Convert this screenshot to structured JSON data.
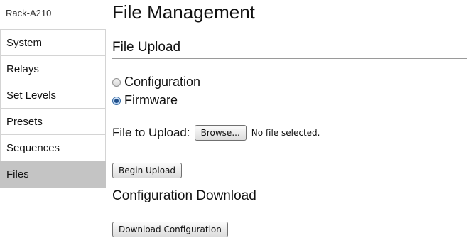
{
  "device": {
    "name": "Rack-A210"
  },
  "sidebar": {
    "items": [
      {
        "label": "System",
        "active": false
      },
      {
        "label": "Relays",
        "active": false
      },
      {
        "label": "Set Levels",
        "active": false
      },
      {
        "label": "Presets",
        "active": false
      },
      {
        "label": "Sequences",
        "active": false
      },
      {
        "label": "Files",
        "active": true
      }
    ]
  },
  "main": {
    "title": "File Management",
    "upload": {
      "title": "File Upload",
      "options": [
        {
          "label": "Configuration",
          "checked": false
        },
        {
          "label": "Firmware",
          "checked": true
        }
      ],
      "file_label": "File to Upload:",
      "browse_label": "Browse...",
      "file_status": "No file selected.",
      "begin_label": "Begin Upload"
    },
    "download": {
      "title": "Configuration Download",
      "button_label": "Download Configuration"
    }
  },
  "colors": {
    "active_nav_bg": "#c4c4c4",
    "nav_border": "#d4d4d4",
    "section_rule": "#9a9a9a",
    "radio_selected": "#1f4f8a"
  }
}
